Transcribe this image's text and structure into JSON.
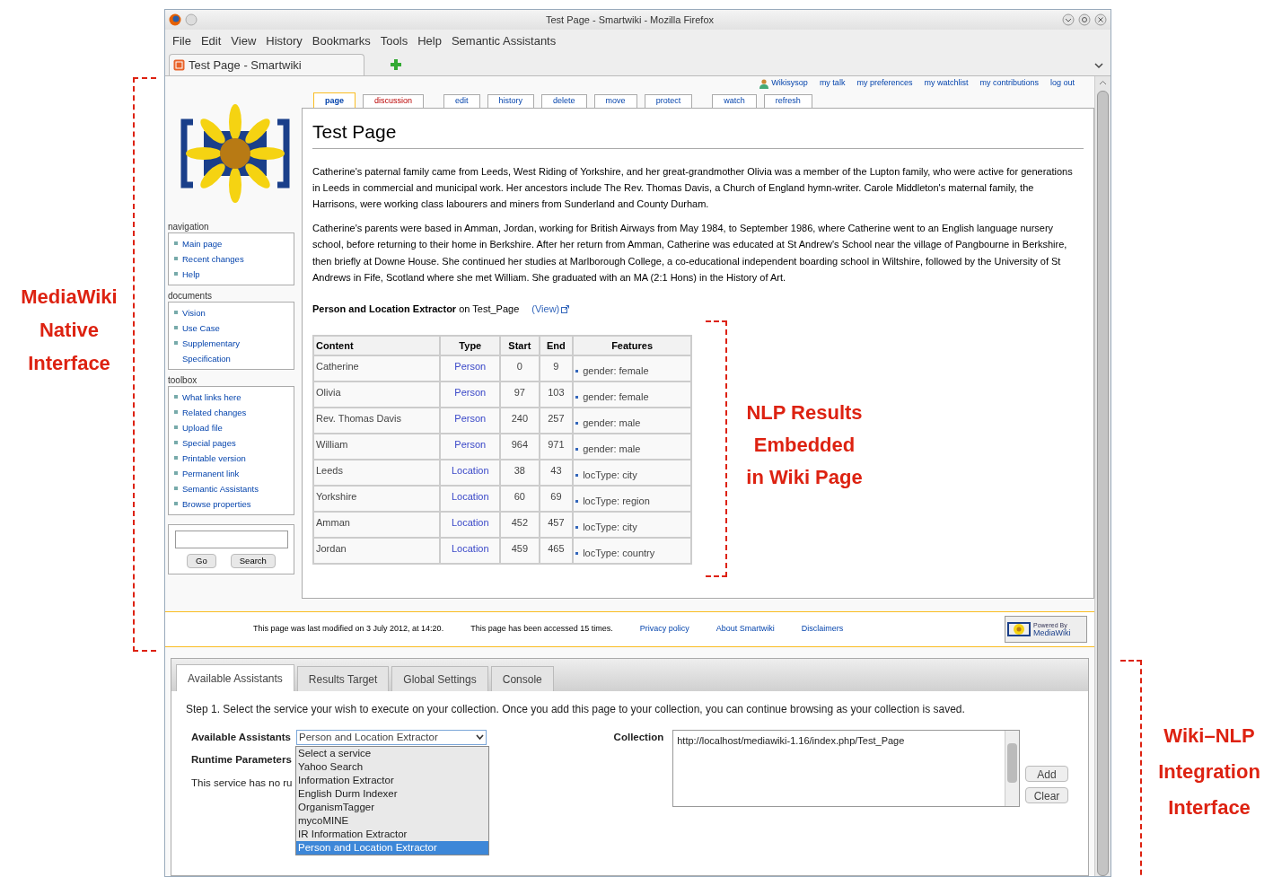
{
  "annotations": [
    {
      "lines": [
        "MediaWiki",
        "Native",
        "Interface"
      ]
    },
    {
      "lines": [
        "NLP Results",
        "Embedded",
        "in Wiki Page"
      ]
    },
    {
      "lines": [
        "Wiki–NLP",
        "Integration",
        "Interface"
      ]
    }
  ],
  "browser": {
    "title": "Test Page - Smartwiki - Mozilla Firefox",
    "menu": [
      "File",
      "Edit",
      "View",
      "History",
      "Bookmarks",
      "Tools",
      "Help",
      "Semantic Assistants"
    ],
    "tab": "Test Page - Smartwiki"
  },
  "personal_links": [
    "Wikisysop",
    "my talk",
    "my preferences",
    "my watchlist",
    "my contributions",
    "log out"
  ],
  "page_tabs": [
    {
      "label": "page",
      "selected": true,
      "missing": false,
      "kind": "view"
    },
    {
      "label": "discussion",
      "selected": false,
      "missing": true,
      "kind": "view"
    },
    {
      "label": "edit",
      "selected": false,
      "missing": false,
      "kind": "action"
    },
    {
      "label": "history",
      "selected": false,
      "missing": false,
      "kind": "action"
    },
    {
      "label": "delete",
      "selected": false,
      "missing": false,
      "kind": "action"
    },
    {
      "label": "move",
      "selected": false,
      "missing": false,
      "kind": "action"
    },
    {
      "label": "protect",
      "selected": false,
      "missing": false,
      "kind": "action"
    },
    {
      "label": "watch",
      "selected": false,
      "missing": false,
      "kind": "watch"
    },
    {
      "label": "refresh",
      "selected": false,
      "missing": false,
      "kind": "watch"
    }
  ],
  "sidebar": {
    "sections": [
      {
        "heading": "navigation",
        "items": [
          "Main page",
          "Recent changes",
          "Help"
        ]
      },
      {
        "heading": "documents",
        "items": [
          "Vision",
          "Use Case",
          "Supplementary Specification"
        ]
      },
      {
        "heading": "toolbox",
        "items": [
          "What links here",
          "Related changes",
          "Upload file",
          "Special pages",
          "Printable version",
          "Permanent link",
          "Semantic Assistants",
          "Browse properties"
        ]
      }
    ],
    "search_buttons": [
      "Go",
      "Search"
    ]
  },
  "article": {
    "title": "Test Page",
    "paragraphs": [
      "Catherine's paternal family came from Leeds, West Riding of Yorkshire, and her great-grandmother Olivia was a member of the Lupton family, who were active for generations in Leeds in commercial and municipal work. Her ancestors include The Rev. Thomas Davis, a Church of England hymn-writer. Carole Middleton's maternal family, the Harrisons, were working class labourers and miners from Sunderland and County Durham.",
      "Catherine's parents were based in Amman, Jordan, working for British Airways from May 1984, to September 1986, where Catherine went to an English language nursery school, before returning to their home in Berkshire. After her return from Amman, Catherine was educated at St Andrew's School near the village of Pangbourne in Berkshire, then briefly at Downe House. She continued her studies at Marlborough College, a co-educational independent boarding school in Wiltshire, followed by the University of St Andrews in Fife, Scotland where she met William. She graduated with an MA (2:1 Hons) in the History of Art."
    ],
    "result_heading": "**Person and Location Extractor** on Test_Page",
    "result_link": "(View)",
    "table": {
      "columns": [
        "Content",
        "Type",
        "Start",
        "End",
        "Features"
      ],
      "rows": [
        [
          "Catherine",
          "Person",
          "0",
          "9",
          "gender: female"
        ],
        [
          "Olivia",
          "Person",
          "97",
          "103",
          "gender: female"
        ],
        [
          "Rev. Thomas Davis",
          "Person",
          "240",
          "257",
          "gender: male"
        ],
        [
          "William",
          "Person",
          "964",
          "971",
          "gender: male"
        ],
        [
          "Leeds",
          "Location",
          "38",
          "43",
          "locType: city"
        ],
        [
          "Yorkshire",
          "Location",
          "60",
          "69",
          "locType: region"
        ],
        [
          "Amman",
          "Location",
          "452",
          "457",
          "locType: city"
        ],
        [
          "Jordan",
          "Location",
          "459",
          "465",
          "locType: country"
        ]
      ]
    }
  },
  "footer": {
    "texts": [
      "This page was last modified on 3 July 2012, at 14:20.",
      "This page has been accessed 15 times."
    ],
    "links": [
      "Privacy policy",
      "About Smartwiki",
      "Disclaimers"
    ],
    "badge": [
      "Powered By",
      "MediaWiki"
    ]
  },
  "assistants": {
    "tabs": [
      {
        "label": "Available Assistants",
        "selected": true
      },
      {
        "label": "Results Target",
        "selected": false
      },
      {
        "label": "Global Settings",
        "selected": false
      },
      {
        "label": "Console",
        "selected": false
      }
    ],
    "step": "Step 1. Select the service your wish to execute on your collection. Once you add this page to your collection, you can continue browsing as your collection is saved.",
    "label": "Available Assistants",
    "select_value": "Person and Location Extractor",
    "dropdown": [
      {
        "label": "Select a service",
        "selected": false
      },
      {
        "label": "Yahoo Search",
        "selected": false
      },
      {
        "label": "Information Extractor",
        "selected": false
      },
      {
        "label": "English Durm Indexer",
        "selected": false
      },
      {
        "label": "OrganismTagger",
        "selected": false
      },
      {
        "label": "mycoMINE",
        "selected": false
      },
      {
        "label": "IR Information Extractor",
        "selected": false
      },
      {
        "label": "Person and Location Extractor",
        "selected": true
      }
    ],
    "runtime_label": "Runtime Parameters",
    "runtime_text": "This service has no ru",
    "collection_label": "Collection",
    "collection_value": "http://localhost/mediawiki-1.16/index.php/Test_Page",
    "buttons": [
      "Add",
      "Clear"
    ]
  }
}
